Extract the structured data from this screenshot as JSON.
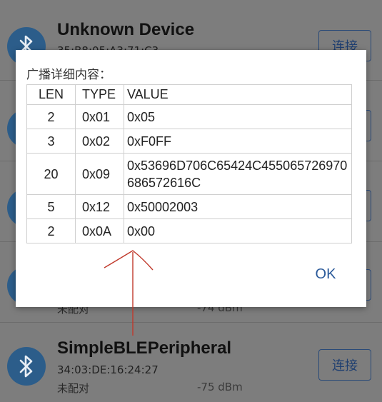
{
  "devices": [
    {
      "name": "Unknown Device",
      "mac": "35:B8:05:A3:71:C3",
      "state": "",
      "rssi": "",
      "connect_label": "连接"
    },
    {
      "name": "",
      "mac": "",
      "state": "",
      "rssi": "",
      "connect_label": ""
    },
    {
      "name": "",
      "mac": "",
      "state": "",
      "rssi": "",
      "connect_label": ""
    },
    {
      "name": "",
      "mac": "",
      "state": "未配对",
      "rssi": "-74 dBm",
      "connect_label": ""
    },
    {
      "name": "SimpleBLEPeripheral",
      "mac": "34:03:DE:16:24:27",
      "state": "未配对",
      "rssi": "-75 dBm",
      "connect_label": "连接"
    }
  ],
  "dialog": {
    "title": "广播详细内容：",
    "columns": [
      "LEN",
      "TYPE",
      "VALUE"
    ],
    "rows": [
      {
        "len": "2",
        "type": "0x01",
        "value": "0x05"
      },
      {
        "len": "3",
        "type": "0x02",
        "value": "0xF0FF"
      },
      {
        "len": "20",
        "type": "0x09",
        "value": "0x53696D706C65424C455065726970686572616C"
      },
      {
        "len": "5",
        "type": "0x12",
        "value": "0x50002003"
      },
      {
        "len": "2",
        "type": "0x0A",
        "value": "0x00"
      }
    ],
    "ok_label": "OK"
  },
  "colors": {
    "accent": "#2b5a9a",
    "bluetooth_badge": "#2c5d8a",
    "annotation": "#c0392b"
  },
  "icons": {
    "device_icon": "bluetooth-icon"
  }
}
